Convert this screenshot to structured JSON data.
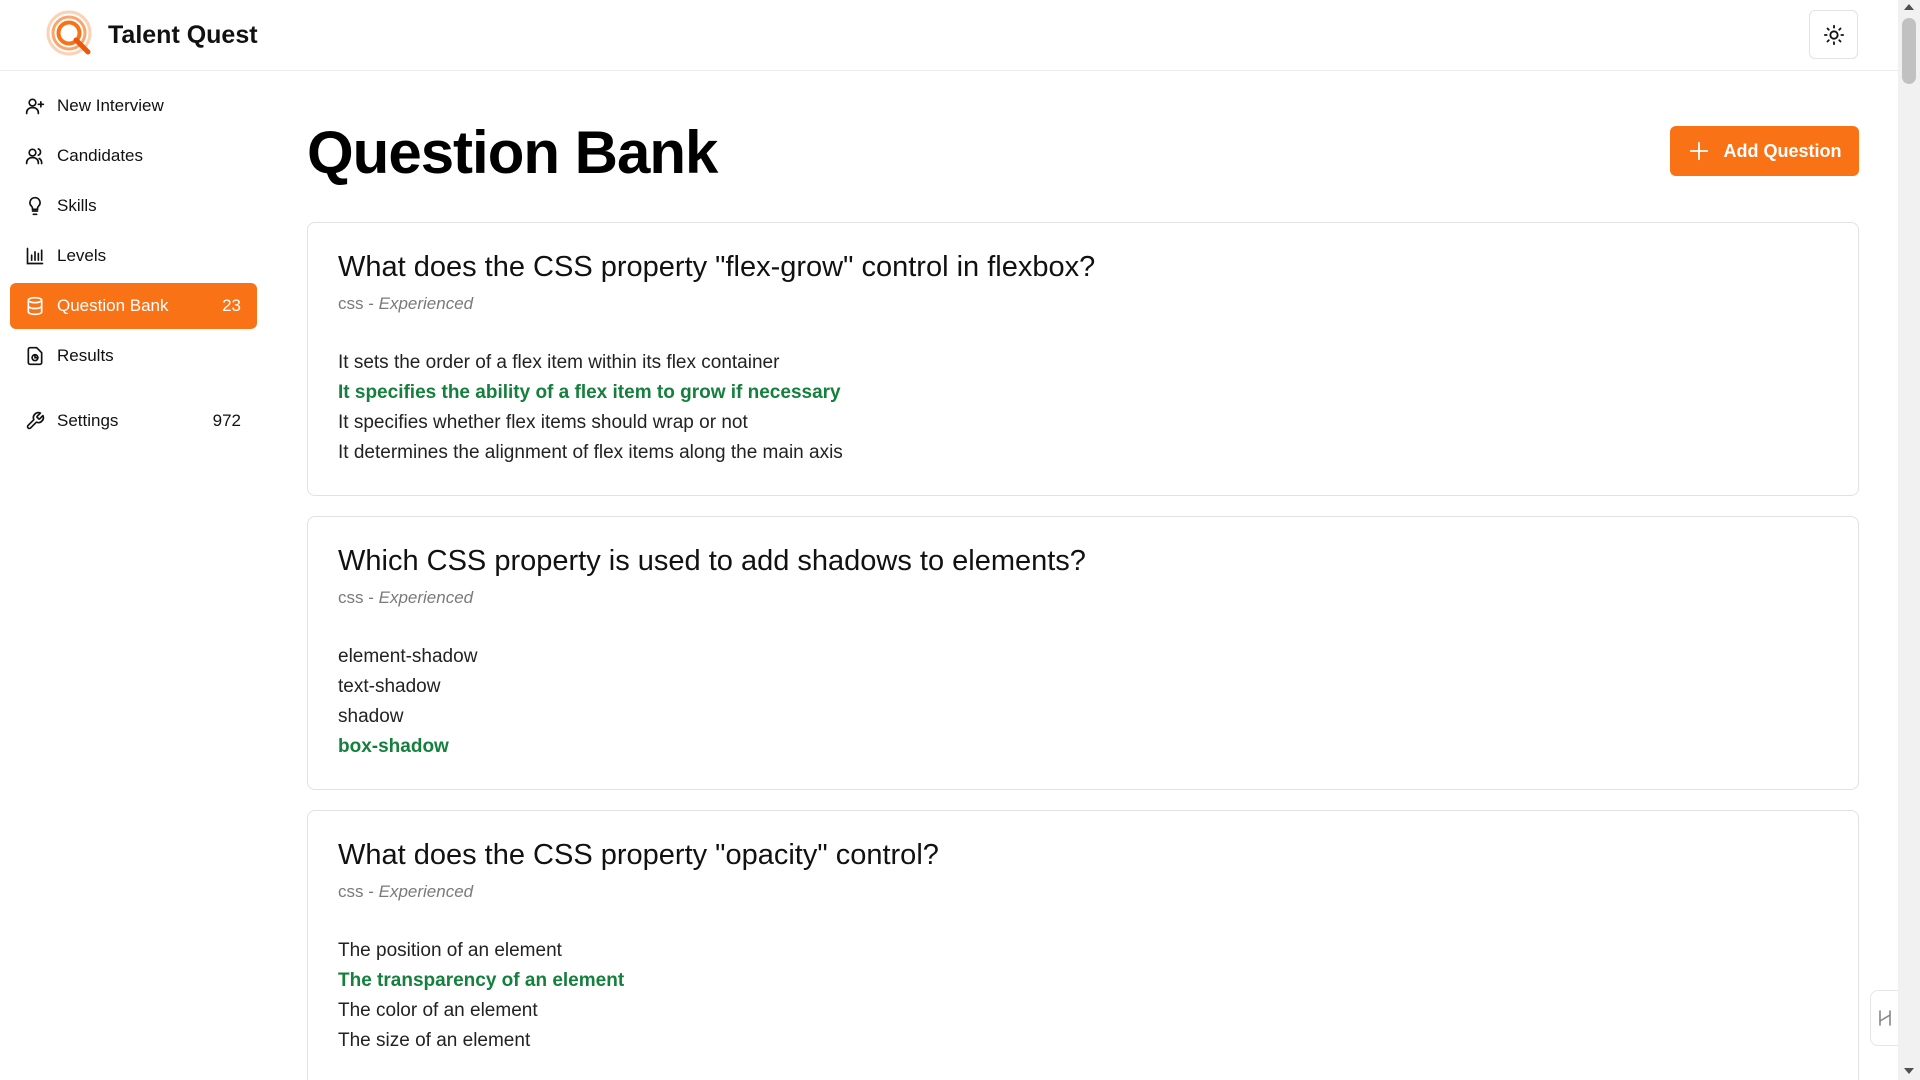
{
  "app": {
    "name": "Talent Quest",
    "logo_icon": "magnifier-logo-icon",
    "theme_toggle_icon": "sun-icon",
    "accent_color": "#f97316",
    "correct_color": "#15803d"
  },
  "sidebar": {
    "items": [
      {
        "label": "New Interview",
        "icon": "user-plus-icon",
        "count": ""
      },
      {
        "label": "Candidates",
        "icon": "users-icon",
        "count": ""
      },
      {
        "label": "Skills",
        "icon": "lightbulb-icon",
        "count": ""
      },
      {
        "label": "Levels",
        "icon": "bar-chart-icon",
        "count": ""
      },
      {
        "label": "Question Bank",
        "icon": "database-icon",
        "count": "23",
        "active": true
      },
      {
        "label": "Results",
        "icon": "file-chart-icon",
        "count": ""
      },
      {
        "label": "Settings",
        "icon": "wrench-icon",
        "count": "972"
      }
    ]
  },
  "main": {
    "title": "Question Bank",
    "add_button_label": "Add Question",
    "questions": [
      {
        "title": "What does the CSS property \"flex-grow\" control in flexbox?",
        "skill": "css",
        "separator": " - ",
        "level": "Experienced",
        "answers": [
          {
            "text": "It sets the order of a flex item within its flex container",
            "correct": false
          },
          {
            "text": "It specifies the ability of a flex item to grow if necessary",
            "correct": true
          },
          {
            "text": "It specifies whether flex items should wrap or not",
            "correct": false
          },
          {
            "text": "It determines the alignment of flex items along the main axis",
            "correct": false
          }
        ]
      },
      {
        "title": "Which CSS property is used to add shadows to elements?",
        "skill": "css",
        "separator": " - ",
        "level": "Experienced",
        "answers": [
          {
            "text": "element-shadow",
            "correct": false
          },
          {
            "text": "text-shadow",
            "correct": false
          },
          {
            "text": "shadow",
            "correct": false
          },
          {
            "text": "box-shadow",
            "correct": true
          }
        ]
      },
      {
        "title": "What does the CSS property \"opacity\" control?",
        "skill": "css",
        "separator": " - ",
        "level": "Experienced",
        "answers": [
          {
            "text": "The position of an element",
            "correct": false
          },
          {
            "text": "The transparency of an element",
            "correct": true
          },
          {
            "text": "The color of an element",
            "correct": false
          },
          {
            "text": "The size of an element",
            "correct": false
          }
        ]
      }
    ]
  }
}
